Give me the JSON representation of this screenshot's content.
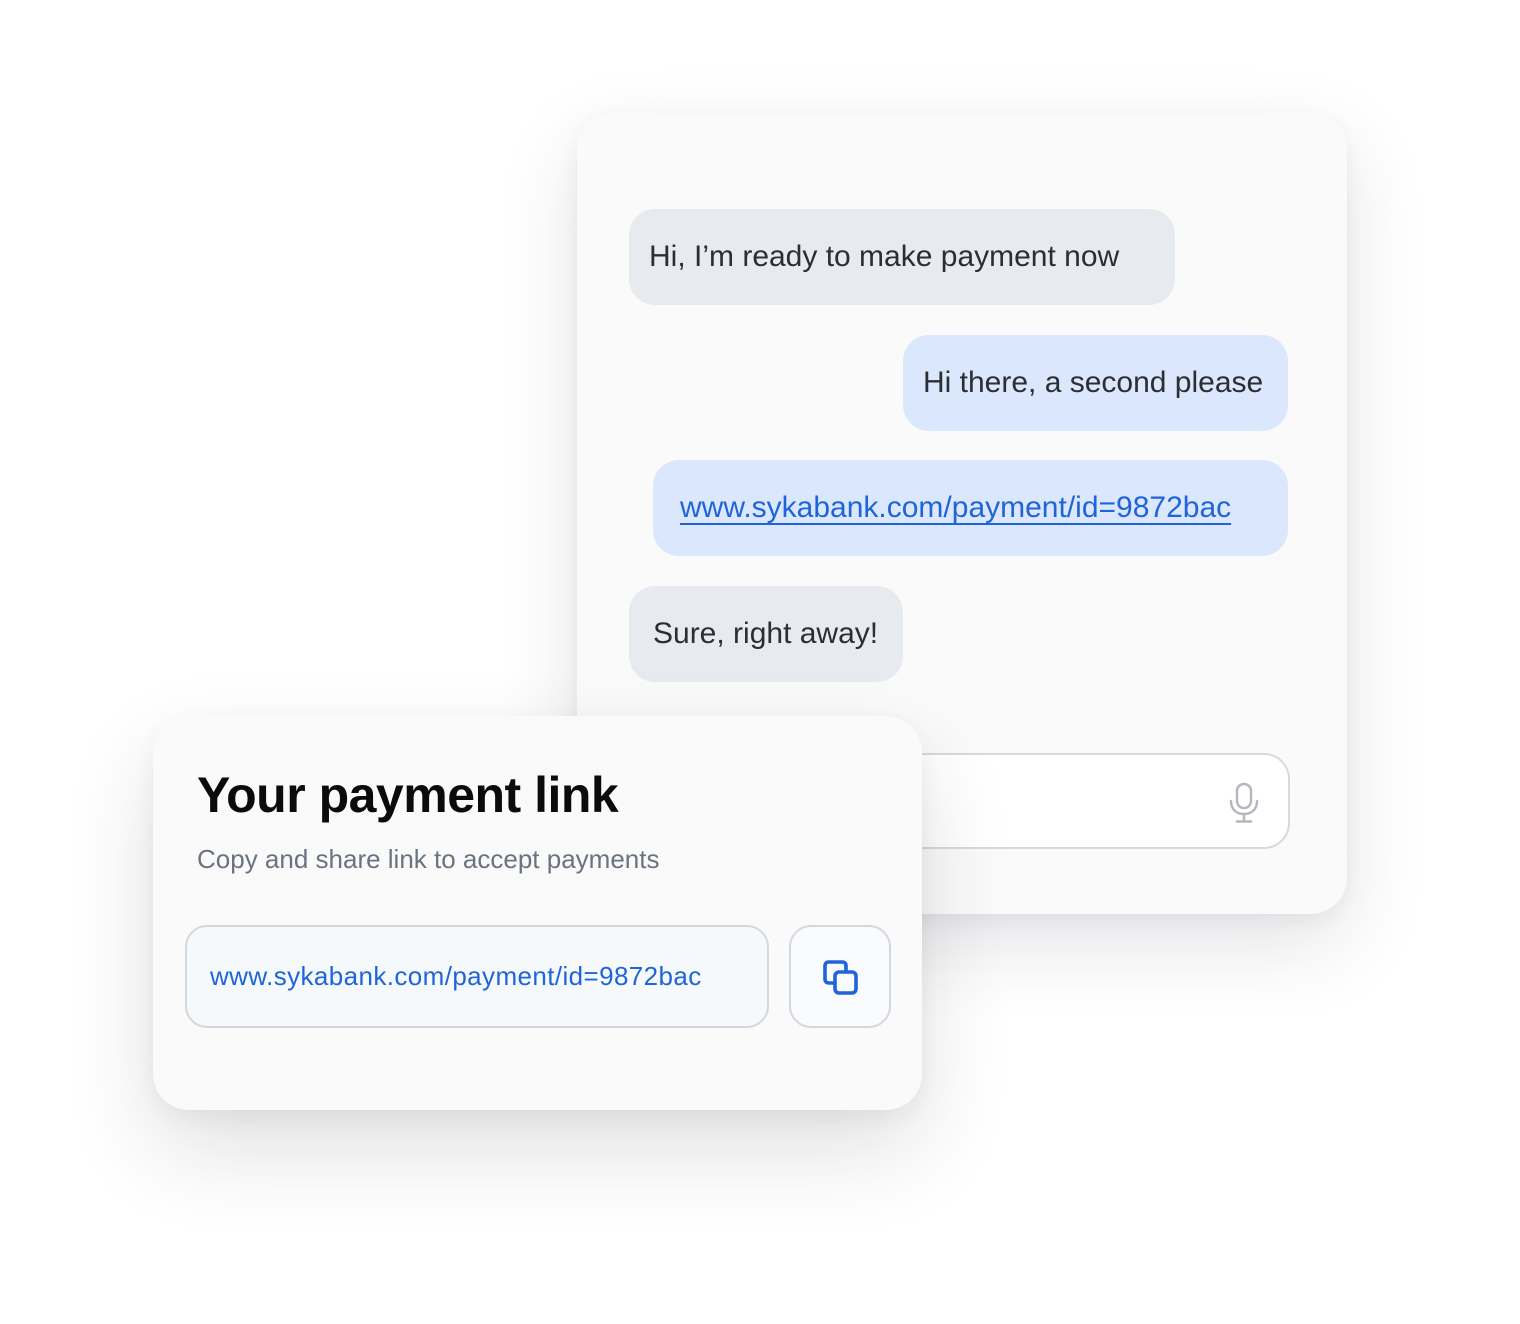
{
  "chat": {
    "messages": [
      {
        "sender": "customer",
        "text": "Hi, I’m ready to make payment now"
      },
      {
        "sender": "agent",
        "text": "Hi there, a second please"
      },
      {
        "sender": "agent",
        "text": "www.sykabank.com/payment/id=9872bac",
        "is_link": true
      },
      {
        "sender": "customer",
        "text": "Sure, right away!"
      }
    ],
    "input": {
      "value": "",
      "mic_icon": "microphone-icon"
    }
  },
  "payment_card": {
    "title": "Your payment link",
    "subtitle": "Copy and share link to accept payments",
    "link": "www.sykabank.com/payment/id=9872bac",
    "copy_icon": "copy-icon"
  },
  "colors": {
    "incoming_bubble": "#e7ebef",
    "outgoing_bubble": "#dbe7fd",
    "link": "#1f64d8",
    "card_background": "#fafafa"
  }
}
